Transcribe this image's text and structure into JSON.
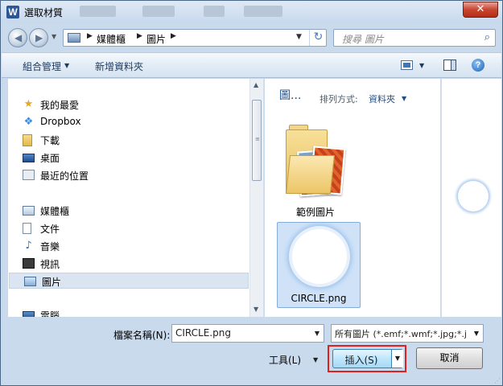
{
  "window": {
    "title": "選取材質",
    "app_icon_letter": "W",
    "close_glyph": "✕"
  },
  "nav": {
    "back_glyph": "◀",
    "forward_glyph": "▶",
    "breadcrumb": [
      "媒體櫃",
      "圖片"
    ],
    "search_placeholder": "搜尋 圖片"
  },
  "toolbar": {
    "organize_label": "組合管理",
    "new_folder_label": "新增資料夾",
    "help_glyph": "?"
  },
  "sidebar": {
    "items": [
      {
        "label": "我的最愛",
        "icon": "star-icon"
      },
      {
        "label": "Dropbox",
        "icon": "dropbox-icon"
      },
      {
        "label": "下載",
        "icon": "download-folder-icon"
      },
      {
        "label": "桌面",
        "icon": "desktop-icon"
      },
      {
        "label": "最近的位置",
        "icon": "recent-places-icon"
      },
      {
        "label": "媒體櫃",
        "icon": "library-icon"
      },
      {
        "label": "文件",
        "icon": "documents-icon"
      },
      {
        "label": "音樂",
        "icon": "music-icon"
      },
      {
        "label": "視訊",
        "icon": "video-icon"
      },
      {
        "label": "圖片",
        "icon": "pictures-icon",
        "selected": true
      },
      {
        "label": "電腦",
        "icon": "computer-icon"
      }
    ]
  },
  "content": {
    "library_title": "圖...",
    "sort_label": "排列方式:",
    "sort_value": "資料夾",
    "files": [
      {
        "name": "範例圖片",
        "type": "folder"
      },
      {
        "name": "CIRCLE.png",
        "type": "image",
        "selected": true
      }
    ]
  },
  "form": {
    "filename_label": "檔案名稱(N):",
    "filename_value": "CIRCLE.png",
    "filetype_value": "所有圖片 (*.emf;*.wmf;*.jpg;*.j",
    "tools_label": "工具(L)",
    "insert_label": "插入(S)",
    "cancel_label": "取消"
  },
  "colors": {
    "highlight_box": "#e02020",
    "selection": "#cfe2f7",
    "accent": "#1f4f8a"
  }
}
